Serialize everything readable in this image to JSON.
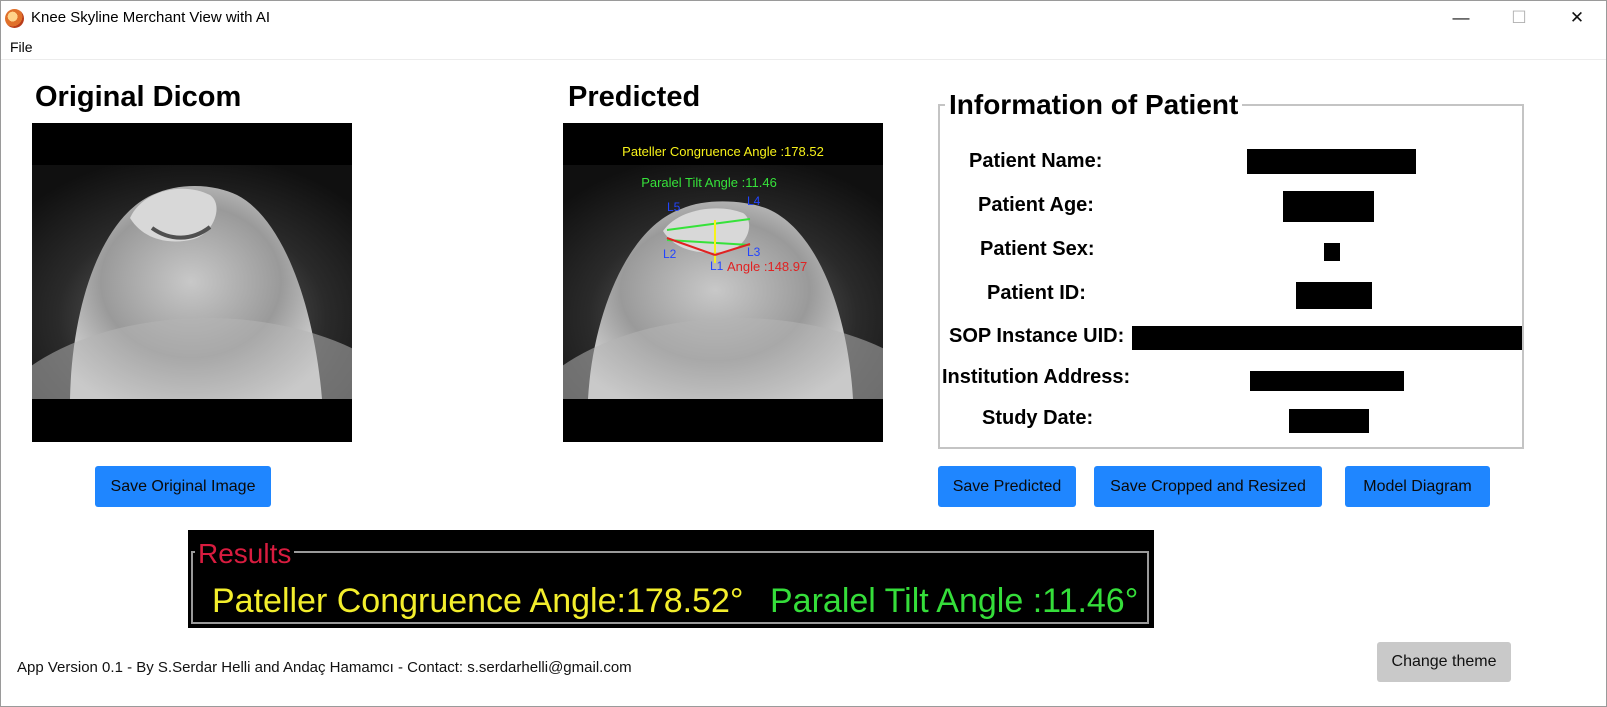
{
  "window": {
    "title": "Knee Skyline Merchant View with AI"
  },
  "menu": {
    "file_label": "File"
  },
  "original": {
    "title": "Original Dicom"
  },
  "predicted": {
    "title": "Predicted",
    "overlay_pca": "Pateller Congruence Angle :178.52",
    "overlay_pta": "Paralel Tilt Angle :11.46",
    "overlay_angle": "Angle :148.97",
    "point_labels": [
      "L5",
      "L4",
      "L2",
      "L1",
      "L3"
    ]
  },
  "buttons": {
    "save_original": "Save Original Image",
    "save_predicted": "Save Predicted",
    "save_cropped": "Save Cropped and Resized",
    "model_diagram": "Model Diagram",
    "change_theme": "Change theme"
  },
  "patient": {
    "title": "Information of Patient",
    "labels": {
      "name": "Patient Name:",
      "age": "Patient Age:",
      "sex": "Patient Sex:",
      "id": "Patient ID:",
      "sop": "SOP Instance UID:",
      "address": "Institution Address:",
      "date": "Study Date:"
    }
  },
  "results": {
    "title": "Results",
    "pca_text": "Pateller Congruence Angle:178.52°",
    "pta_text": "Paralel Tilt Angle :11.46°"
  },
  "footer": {
    "text": "App Version 0.1 - By S.Serdar Helli and Andaç Hamamcı - Contact: s.serdarhelli@gmail.com"
  },
  "colors": {
    "button_blue": "#1f86ff",
    "results_title": "#d81c3f",
    "results_pca": "#f3ee2c",
    "results_pta": "#35de3a",
    "overlay_line_green": "#36e23a",
    "overlay_line_yellow": "#f7f21a",
    "overlay_line_red": "#e02222",
    "overlay_label_blue": "#2244ff"
  }
}
